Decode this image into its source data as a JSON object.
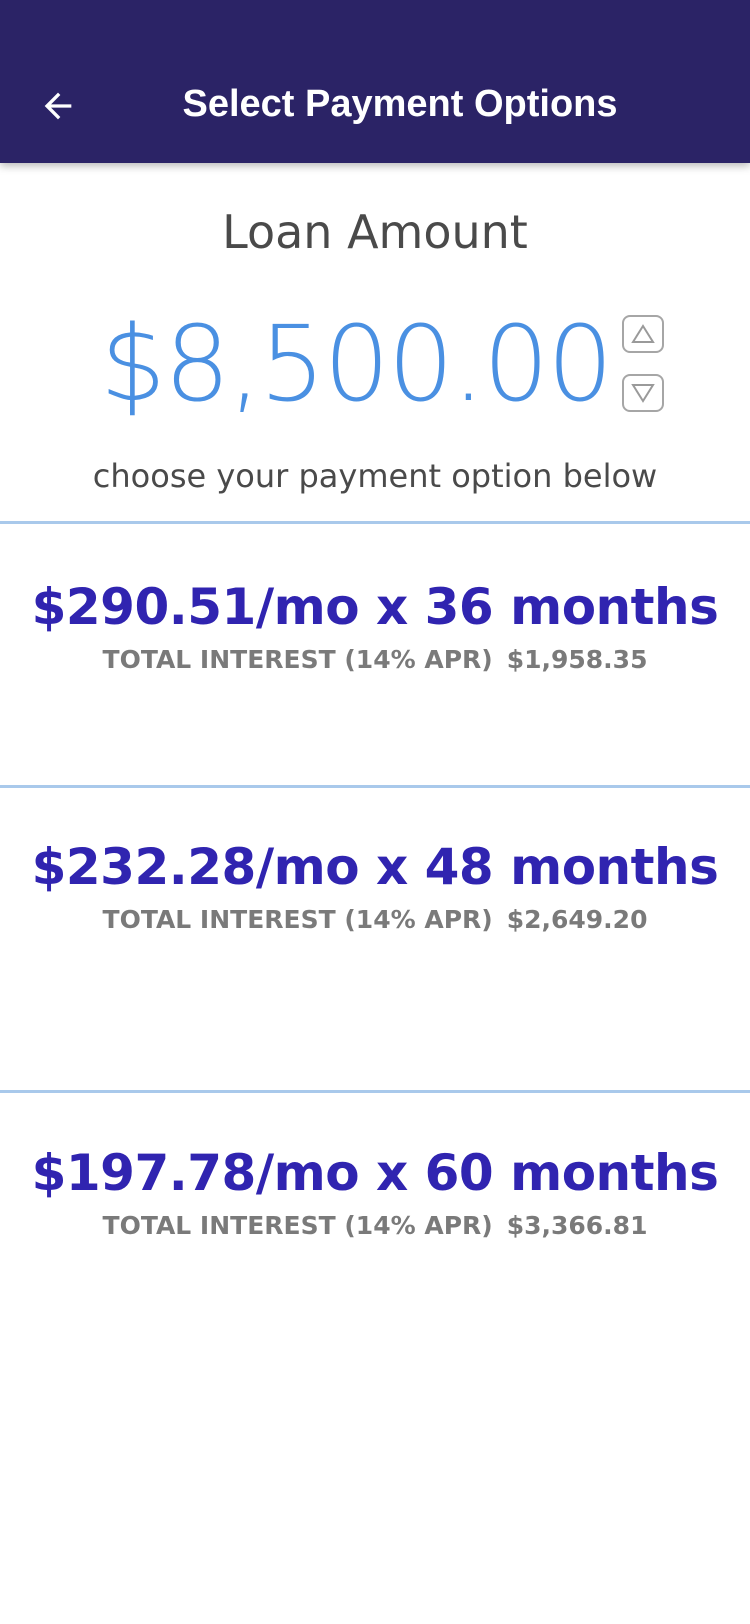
{
  "app_bar": {
    "title": "Select Payment Options",
    "back_icon": "arrow-left-icon",
    "background_color": "#2b2366"
  },
  "loan": {
    "label": "Loan Amount",
    "amount": "$8,500.00",
    "amount_color": "#4a90e2",
    "increase_icon": "triangle-up-icon",
    "decrease_icon": "triangle-down-icon"
  },
  "instructions": "choose your payment option below",
  "payment_options": [
    {
      "payment": "$290.51/mo x 36 months",
      "interest_label": "TOTAL INTEREST (14% APR)",
      "interest_value": "$1,958.35"
    },
    {
      "payment": "$232.28/mo x 48 months",
      "interest_label": "TOTAL INTEREST (14% APR)",
      "interest_value": "$2,649.20"
    },
    {
      "payment": "$197.78/mo x 60 months",
      "interest_label": "TOTAL INTEREST (14% APR)",
      "interest_value": "$3,366.81"
    }
  ],
  "colors": {
    "payment_text": "#3024b0",
    "interest_text": "#7a7a7a",
    "divider": "#a9c9eb"
  }
}
